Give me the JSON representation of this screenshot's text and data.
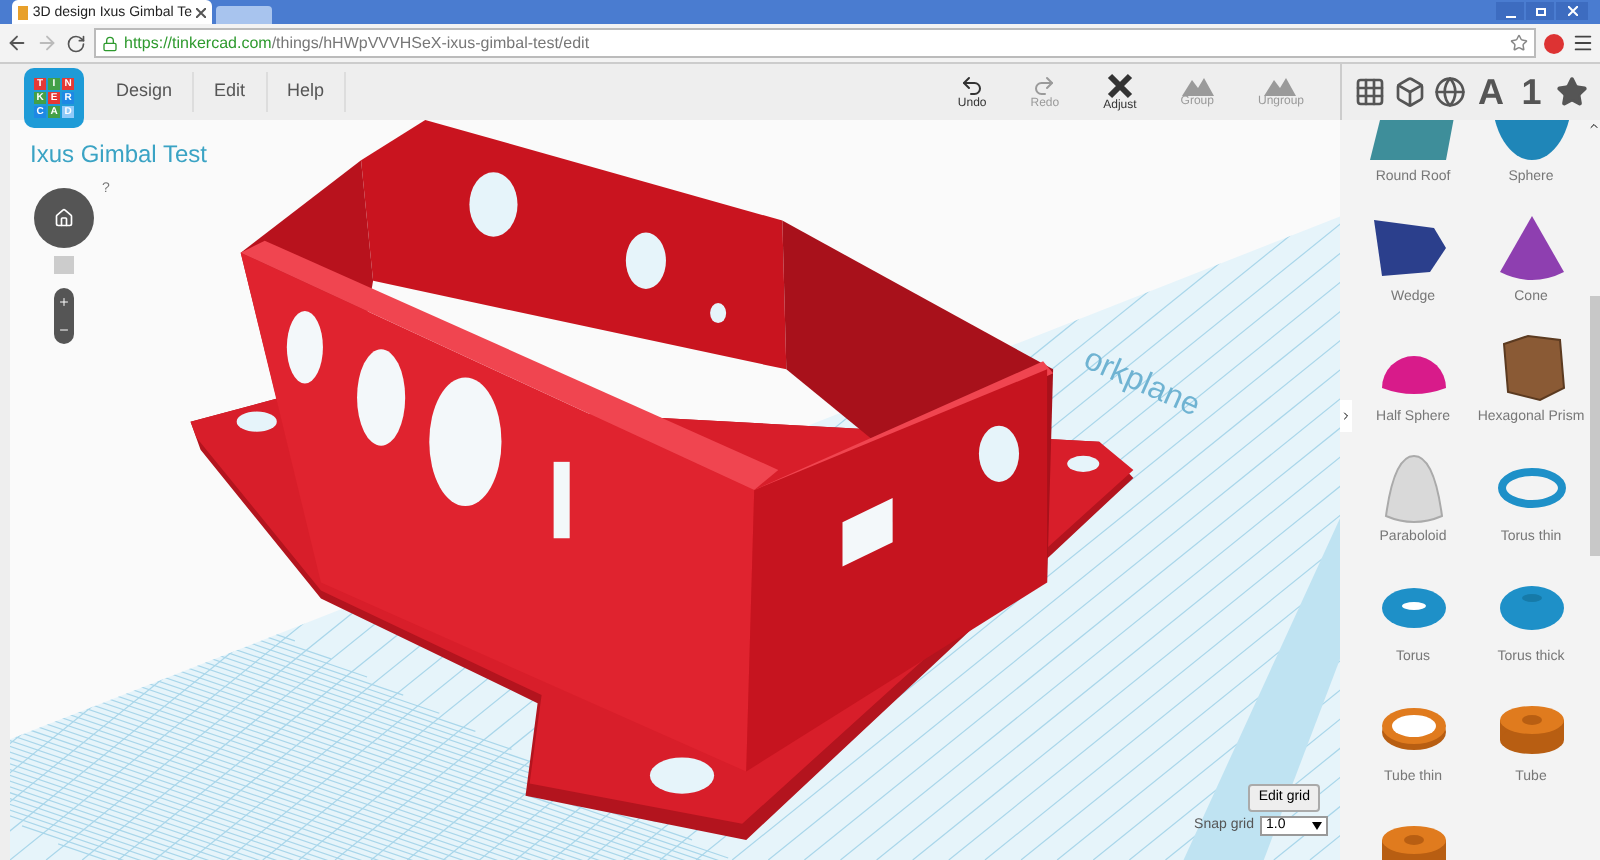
{
  "browser": {
    "tab_title": "3D design Ixus Gimbal Te",
    "url_host": "https://tinkercad.com",
    "url_path": "/things/hHWpVVVHSeX-ixus-gimbal-test/edit"
  },
  "logo": [
    {
      "letter": "T",
      "color": "#e53935"
    },
    {
      "letter": "I",
      "color": "#43a047"
    },
    {
      "letter": "N",
      "color": "#e53935"
    },
    {
      "letter": "K",
      "color": "#43a047"
    },
    {
      "letter": "E",
      "color": "#e53935"
    },
    {
      "letter": "R",
      "color": "#1e88e5"
    },
    {
      "letter": "C",
      "color": "#1e88e5"
    },
    {
      "letter": "A",
      "color": "#43a047"
    },
    {
      "letter": "D",
      "color": "#90caf9"
    }
  ],
  "menu": [
    "Design",
    "Edit",
    "Help"
  ],
  "toolbar": [
    {
      "kind": "undo",
      "label": "Undo",
      "disabled": false
    },
    {
      "kind": "redo",
      "label": "Redo",
      "disabled": true
    },
    {
      "kind": "adjust",
      "label": "Adjust",
      "disabled": false
    },
    {
      "kind": "group",
      "label": "Group",
      "disabled": true
    },
    {
      "kind": "ungroup",
      "label": "Ungroup",
      "disabled": true
    }
  ],
  "palette_tabs": [
    {
      "kind": "grid"
    },
    {
      "kind": "box"
    },
    {
      "kind": "globe"
    },
    {
      "kind": "text",
      "label": "A"
    },
    {
      "kind": "text",
      "label": "1"
    },
    {
      "kind": "star"
    }
  ],
  "design_title": "Ixus Gimbal Test",
  "help_mark": "?",
  "workplane_label": "orkplane",
  "shapes": [
    {
      "kind": "roof",
      "label": "Round Roof",
      "color": "#3e8e9a"
    },
    {
      "kind": "sphere",
      "label": "Sphere",
      "color": "#1f86b8"
    },
    {
      "kind": "wedge",
      "label": "Wedge",
      "color": "#2b3f8c"
    },
    {
      "kind": "cone",
      "label": "Cone",
      "color": "#8e3fb0"
    },
    {
      "kind": "halfsphere",
      "label": "Half Sphere",
      "color": "#d81b8a"
    },
    {
      "kind": "prism",
      "label": "Hexagonal Prism",
      "color": "#8a5a35"
    },
    {
      "kind": "paraboloid",
      "label": "Paraboloid",
      "color": "#d9d9d9"
    },
    {
      "kind": "torusthin",
      "label": "Torus thin",
      "color": "#1e90c8"
    },
    {
      "kind": "torus",
      "label": "Torus",
      "color": "#1e90c8"
    },
    {
      "kind": "torusthick",
      "label": "Torus thick",
      "color": "#1e90c8"
    },
    {
      "kind": "tubethin",
      "label": "Tube thin",
      "color": "#e07b1e"
    },
    {
      "kind": "tube",
      "label": "Tube",
      "color": "#e07b1e"
    },
    {
      "kind": "tube",
      "color": "#e07b1e"
    }
  ],
  "grid_controls": {
    "edit_button": "Edit grid",
    "snap_label": "Snap grid",
    "snap_value": "1.0"
  }
}
